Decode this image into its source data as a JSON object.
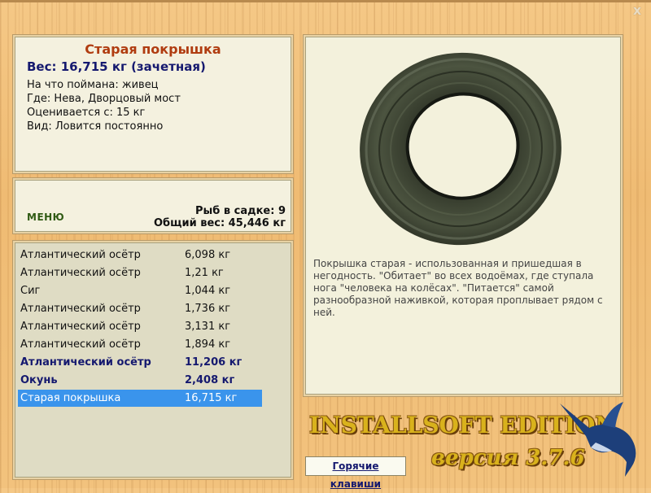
{
  "window": {
    "close_glyph": "x"
  },
  "catch": {
    "title": "Старая покрышка",
    "weight": "Вес: 16,715 кг (зачетная)",
    "bait": "На что поймана: живец",
    "location": "Где: Нева, Дворцовый мост",
    "valued": "Оценивается с: 15 кг",
    "type": "Вид: Ловится постоянно",
    "description": "Покрышка старая - использованная и пришедшая в негодность. \"Обитает\" во всех водоёмах, где ступала нога \"человека на колёсах\". \"Питается\" самой разнообразной наживкой, которая проплывает рядом с ней."
  },
  "status": {
    "menu_label": "МЕНЮ",
    "fish_in_keepnet": "Рыб в садке: 9",
    "total_weight": "Общий вес: 45,446 кг"
  },
  "keepnet": [
    {
      "name": "Атлантический осётр",
      "weight": "6,098 кг",
      "style": "normal"
    },
    {
      "name": "Атлантический осётр",
      "weight": "1,21 кг",
      "style": "normal"
    },
    {
      "name": "Сиг",
      "weight": "1,044 кг",
      "style": "normal"
    },
    {
      "name": "Атлантический осётр",
      "weight": "1,736 кг",
      "style": "normal"
    },
    {
      "name": "Атлантический осётр",
      "weight": "3,131 кг",
      "style": "normal"
    },
    {
      "name": "Атлантический осётр",
      "weight": "1,894 кг",
      "style": "normal"
    },
    {
      "name": "Атлантический осётр",
      "weight": "11,206 кг",
      "style": "bold"
    },
    {
      "name": "Окунь",
      "weight": "2,408 кг",
      "style": "bold"
    },
    {
      "name": "Старая покрышка",
      "weight": "16,715 кг",
      "style": "selected"
    }
  ],
  "footer": {
    "hotkeys_label": "Горячие клавиши",
    "edition": "INSTALLSOFT EDITION",
    "version": "версия 3.7.6"
  },
  "colors": {
    "title": "#b03c10",
    "highlight_text": "#15196f",
    "selection": "#3a94ec",
    "menu": "#2f5a13"
  }
}
